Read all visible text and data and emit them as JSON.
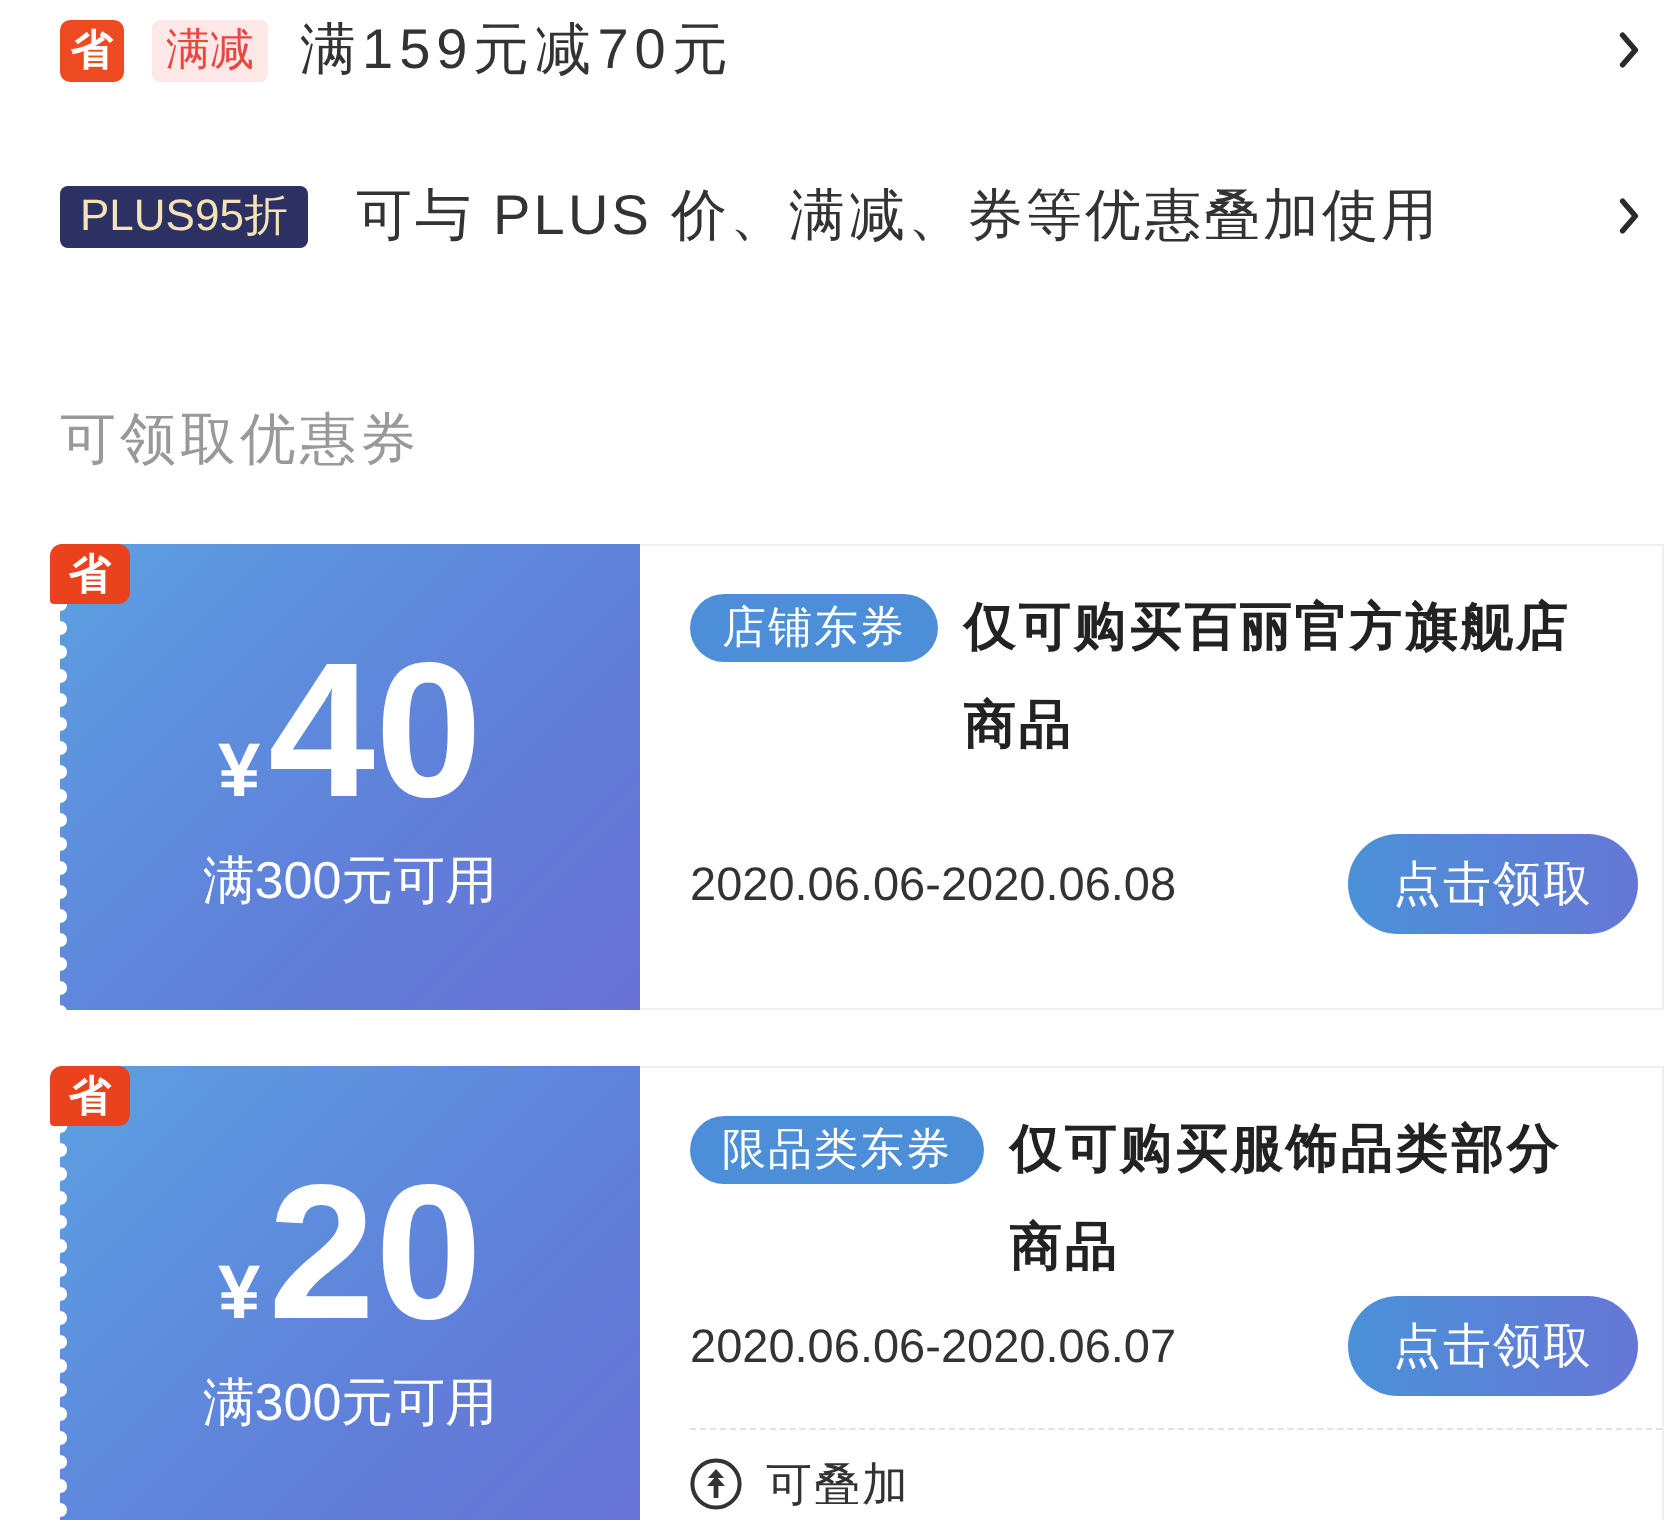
{
  "promotions": [
    {
      "kind": "discount",
      "badge": "省",
      "tag": "满减",
      "text": "满159元减70元"
    },
    {
      "kind": "plus",
      "tag": "PLUS95折",
      "text": "可与 PLUS 价、满减、券等优惠叠加使用"
    }
  ],
  "section_title": "可领取优惠券",
  "coupons": [
    {
      "corner_badge": "省",
      "currency": "¥",
      "amount": "40",
      "condition": "满300元可用",
      "tag": "店铺东券",
      "title": "仅可购买百丽官方旗舰店商品",
      "validity": "2020.06.06-2020.06.08",
      "button": "点击领取"
    },
    {
      "corner_badge": "省",
      "currency": "¥",
      "amount": "20",
      "condition": "满300元可用",
      "tag": "限品类东券",
      "title": "仅可购买服饰品类部分商品",
      "validity": "2020.06.06-2020.06.07",
      "button": "点击领取",
      "stackable": "可叠加"
    }
  ]
}
